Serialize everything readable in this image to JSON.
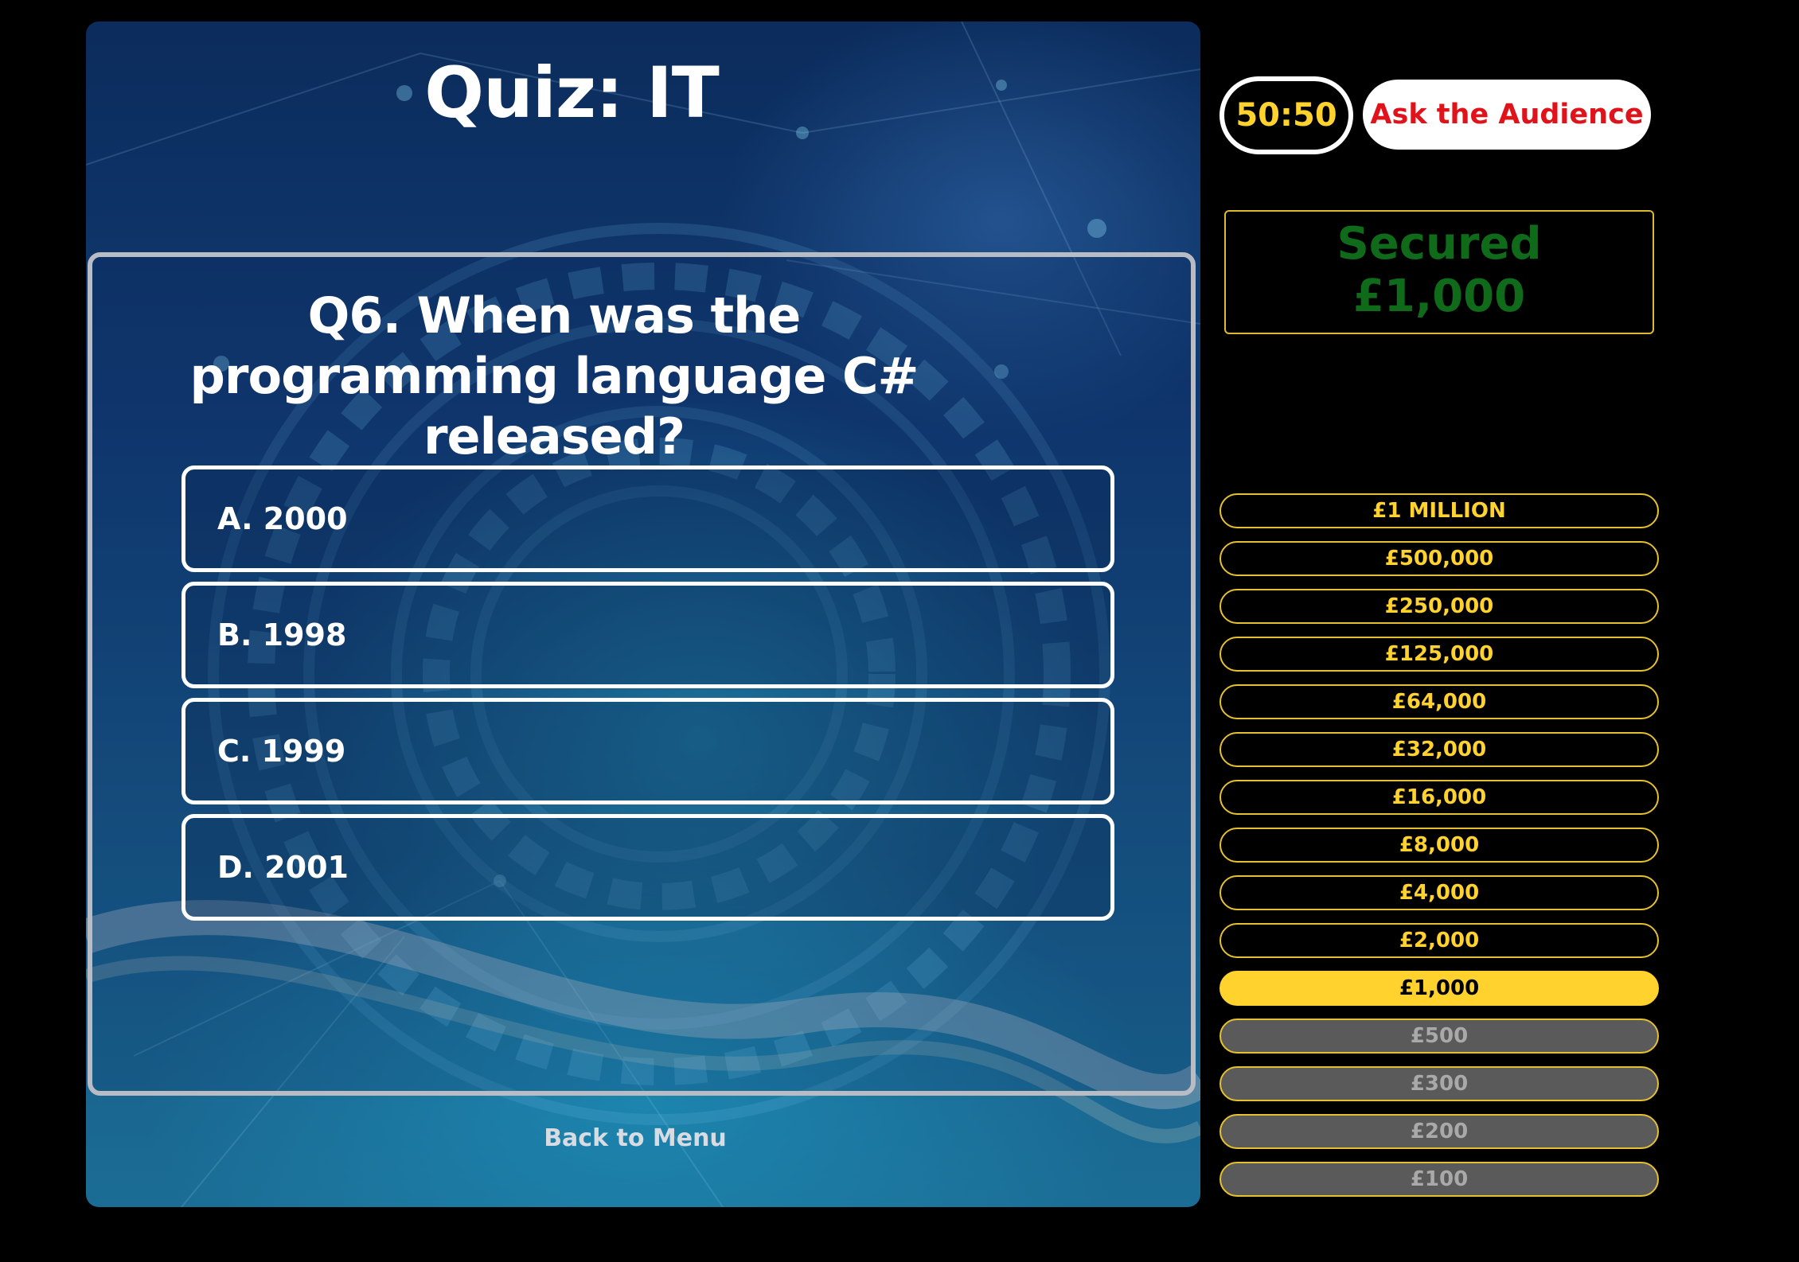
{
  "quiz": {
    "title": "Quiz: IT",
    "question": "Q6. When was the programming language C# released?",
    "answers": [
      {
        "label": "A. 2000"
      },
      {
        "label": "B. 1998"
      },
      {
        "label": "C. 1999"
      },
      {
        "label": "D. 2001"
      }
    ],
    "back_label": "Back to Menu"
  },
  "lifelines": {
    "fifty_fifty": "50:50",
    "ask_audience": "Ask the Audience"
  },
  "secured": {
    "label": "Secured",
    "amount": "£1,000"
  },
  "ladder": {
    "levels": [
      {
        "amount": "£1 MILLION",
        "state": "upcoming"
      },
      {
        "amount": "£500,000",
        "state": "upcoming"
      },
      {
        "amount": "£250,000",
        "state": "upcoming"
      },
      {
        "amount": "£125,000",
        "state": "upcoming"
      },
      {
        "amount": "£64,000",
        "state": "upcoming"
      },
      {
        "amount": "£32,000",
        "state": "upcoming"
      },
      {
        "amount": "£16,000",
        "state": "upcoming"
      },
      {
        "amount": "£8,000",
        "state": "upcoming"
      },
      {
        "amount": "£4,000",
        "state": "upcoming"
      },
      {
        "amount": "£2,000",
        "state": "upcoming"
      },
      {
        "amount": "£1,000",
        "state": "current"
      },
      {
        "amount": "£500",
        "state": "passed"
      },
      {
        "amount": "£300",
        "state": "passed"
      },
      {
        "amount": "£200",
        "state": "passed"
      },
      {
        "amount": "£100",
        "state": "passed"
      }
    ]
  },
  "colors": {
    "accent_yellow": "#ffd22e",
    "secured_green": "#0f6a1a",
    "audience_red": "#e0121a",
    "passed_grey": "#5a5a5a"
  }
}
